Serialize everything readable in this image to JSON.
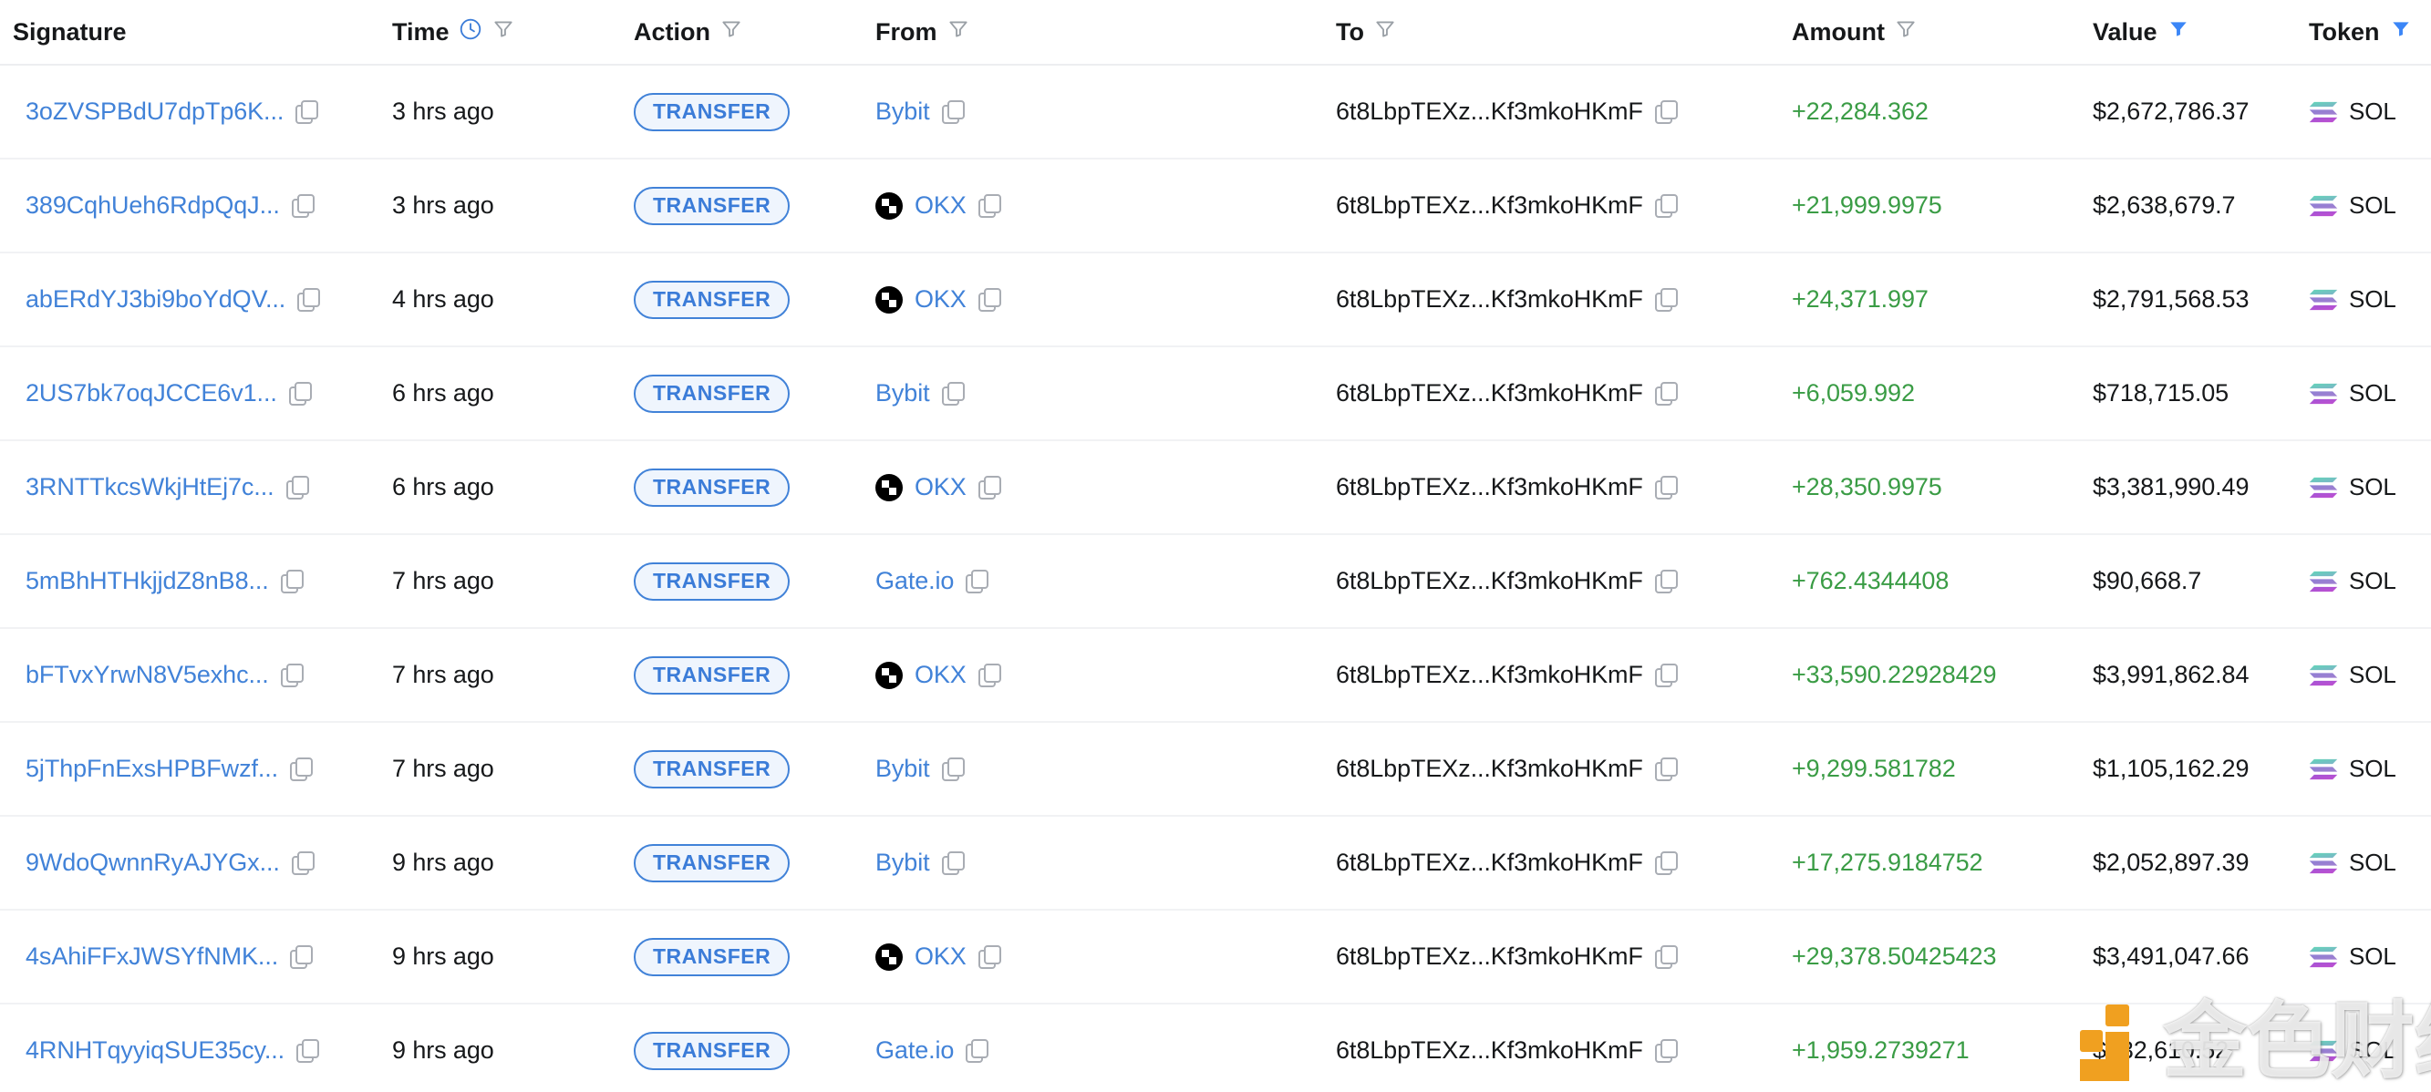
{
  "table": {
    "columns": [
      {
        "key": "signature",
        "label": "Signature",
        "filter": false,
        "filter_active": false,
        "clock": false
      },
      {
        "key": "time",
        "label": "Time",
        "filter": true,
        "filter_active": false,
        "clock": true
      },
      {
        "key": "action",
        "label": "Action",
        "filter": true,
        "filter_active": false,
        "clock": false
      },
      {
        "key": "from",
        "label": "From",
        "filter": true,
        "filter_active": false,
        "clock": false
      },
      {
        "key": "to",
        "label": "To",
        "filter": true,
        "filter_active": false,
        "clock": false
      },
      {
        "key": "amount",
        "label": "Amount",
        "filter": true,
        "filter_active": false,
        "clock": false
      },
      {
        "key": "value",
        "label": "Value",
        "filter": true,
        "filter_active": true,
        "clock": false
      },
      {
        "key": "token",
        "label": "Token",
        "filter": true,
        "filter_active": true,
        "clock": false
      }
    ],
    "rows": [
      {
        "signature": "3oZVSPBdU7dpTp6K...",
        "time": "3 hrs ago",
        "action": "TRANSFER",
        "from": "Bybit",
        "from_icon": "none",
        "to": "6t8LbpTEXz...Kf3mkoHKmF",
        "amount": "+22,284.362",
        "value": "$2,672,786.37",
        "token": "SOL"
      },
      {
        "signature": "389CqhUeh6RdpQqJ...",
        "time": "3 hrs ago",
        "action": "TRANSFER",
        "from": "OKX",
        "from_icon": "okx-icon",
        "to": "6t8LbpTEXz...Kf3mkoHKmF",
        "amount": "+21,999.9975",
        "value": "$2,638,679.7",
        "token": "SOL"
      },
      {
        "signature": "abERdYJ3bi9boYdQV...",
        "time": "4 hrs ago",
        "action": "TRANSFER",
        "from": "OKX",
        "from_icon": "okx-icon",
        "to": "6t8LbpTEXz...Kf3mkoHKmF",
        "amount": "+24,371.997",
        "value": "$2,791,568.53",
        "token": "SOL"
      },
      {
        "signature": "2US7bk7oqJCCE6v1...",
        "time": "6 hrs ago",
        "action": "TRANSFER",
        "from": "Bybit",
        "from_icon": "none",
        "to": "6t8LbpTEXz...Kf3mkoHKmF",
        "amount": "+6,059.992",
        "value": "$718,715.05",
        "token": "SOL"
      },
      {
        "signature": "3RNTTkcsWkjHtEj7c...",
        "time": "6 hrs ago",
        "action": "TRANSFER",
        "from": "OKX",
        "from_icon": "okx-icon",
        "to": "6t8LbpTEXz...Kf3mkoHKmF",
        "amount": "+28,350.9975",
        "value": "$3,381,990.49",
        "token": "SOL"
      },
      {
        "signature": "5mBhHTHkjjdZ8nB8...",
        "time": "7 hrs ago",
        "action": "TRANSFER",
        "from": "Gate.io",
        "from_icon": "none",
        "to": "6t8LbpTEXz...Kf3mkoHKmF",
        "amount": "+762.4344408",
        "value": "$90,668.7",
        "token": "SOL"
      },
      {
        "signature": "bFTvxYrwN8V5exhc...",
        "time": "7 hrs ago",
        "action": "TRANSFER",
        "from": "OKX",
        "from_icon": "okx-icon",
        "to": "6t8LbpTEXz...Kf3mkoHKmF",
        "amount": "+33,590.22928429",
        "value": "$3,991,862.84",
        "token": "SOL"
      },
      {
        "signature": "5jThpFnExsHPBFwzf...",
        "time": "7 hrs ago",
        "action": "TRANSFER",
        "from": "Bybit",
        "from_icon": "none",
        "to": "6t8LbpTEXz...Kf3mkoHKmF",
        "amount": "+9,299.581782",
        "value": "$1,105,162.29",
        "token": "SOL"
      },
      {
        "signature": "9WdoQwnnRyAJYGx...",
        "time": "9 hrs ago",
        "action": "TRANSFER",
        "from": "Bybit",
        "from_icon": "none",
        "to": "6t8LbpTEXz...Kf3mkoHKmF",
        "amount": "+17,275.9184752",
        "value": "$2,052,897.39",
        "token": "SOL"
      },
      {
        "signature": "4sAhiFFxJWSYfNMK...",
        "time": "9 hrs ago",
        "action": "TRANSFER",
        "from": "OKX",
        "from_icon": "okx-icon",
        "to": "6t8LbpTEXz...Kf3mkoHKmF",
        "amount": "+29,378.50425423",
        "value": "$3,491,047.66",
        "token": "SOL"
      },
      {
        "signature": "4RNHTqyyiqSUE35cy...",
        "time": "9 hrs ago",
        "action": "TRANSFER",
        "from": "Gate.io",
        "from_icon": "none",
        "to": "6t8LbpTEXz...Kf3mkoHKmF",
        "amount": "+1,959.2739271",
        "value": "$232,610.52",
        "token": "SOL"
      }
    ]
  },
  "watermark": {
    "text": "金色财经",
    "logo_color": "#F0A020"
  },
  "colors": {
    "link": "#4182d8",
    "amount_positive": "#3a9c45",
    "badge_border": "#4182d8",
    "badge_bg": "#eff5fd",
    "filter_active": "#3b86f7",
    "filter_inactive": "#9aa0a6",
    "row_divider": "#f1f2f4"
  }
}
